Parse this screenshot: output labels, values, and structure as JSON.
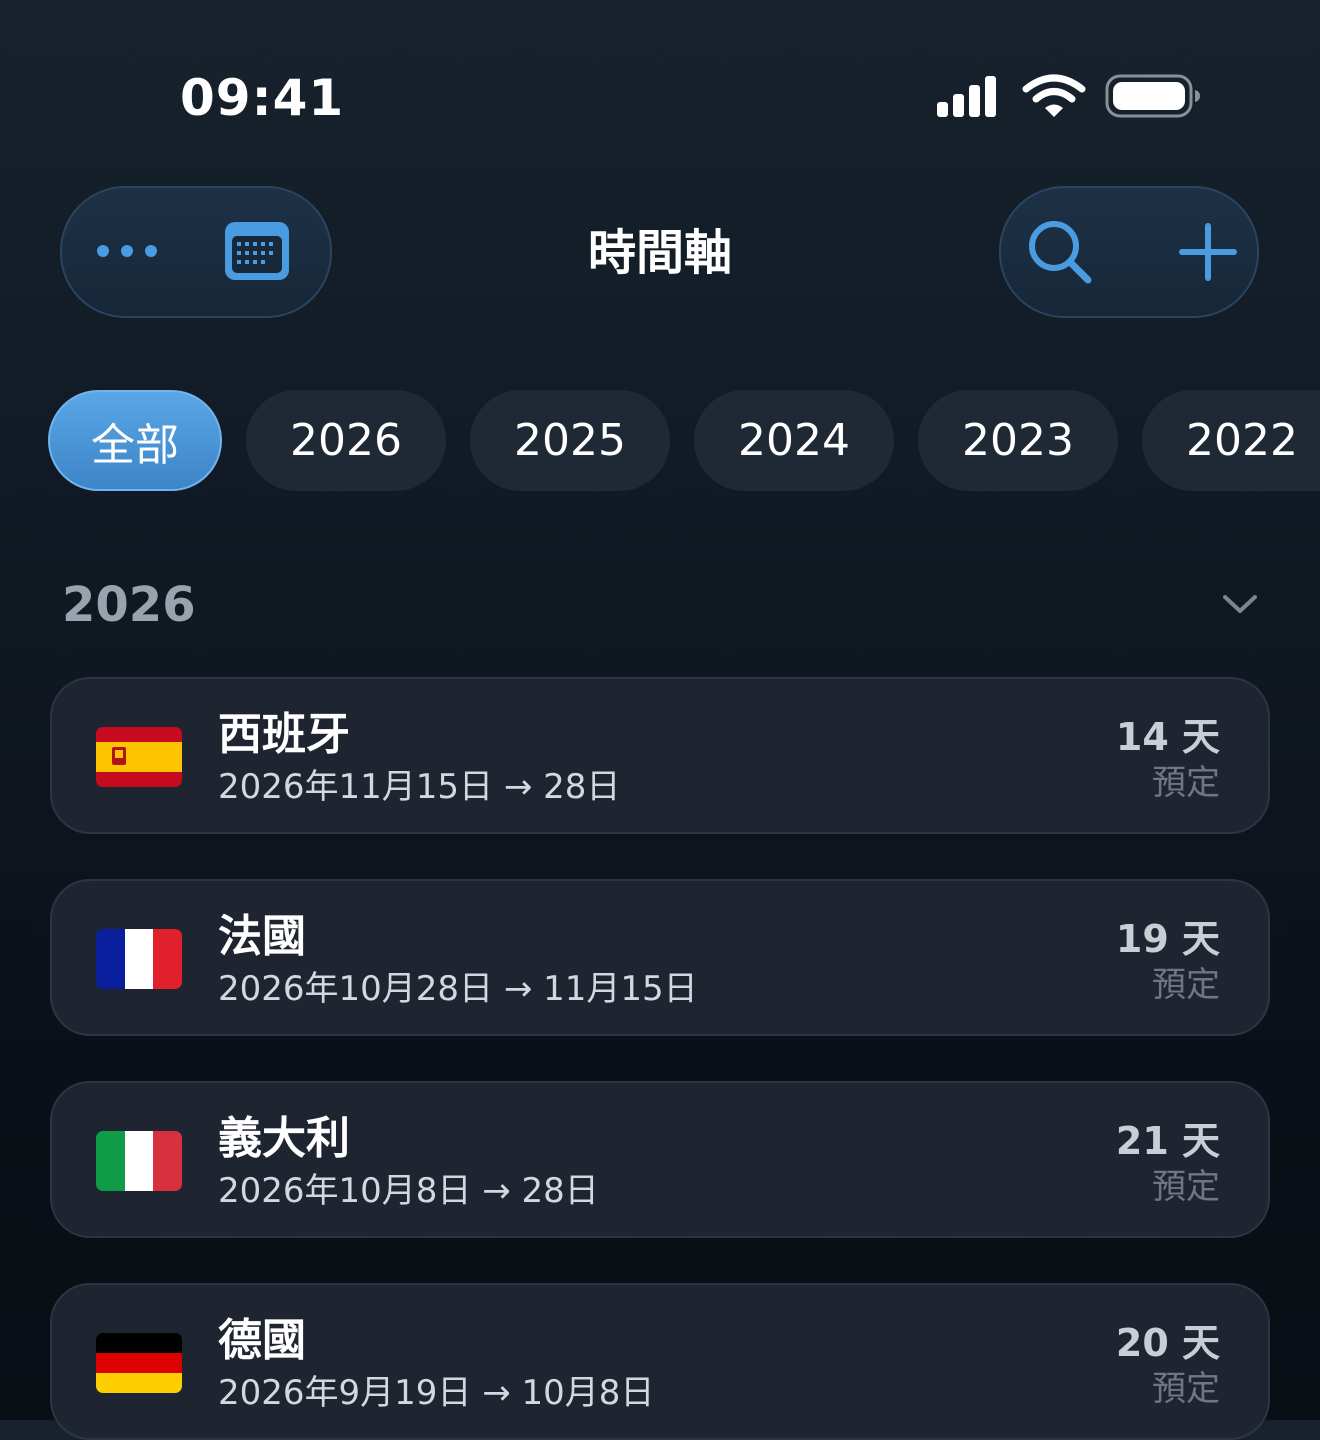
{
  "status_bar": {
    "time": "09:41",
    "signal_icon": "cellular-signal-icon",
    "wifi_icon": "wifi-icon",
    "battery_icon": "battery-icon"
  },
  "toolbar": {
    "title": "時間軸",
    "more_icon": "ellipsis-icon",
    "calendar_icon": "calendar-icon",
    "search_icon": "search-icon",
    "add_icon": "plus-icon",
    "accent_color": "#4a9be0"
  },
  "filters": [
    {
      "label": "全部",
      "active": true
    },
    {
      "label": "2026",
      "active": false
    },
    {
      "label": "2025",
      "active": false
    },
    {
      "label": "2024",
      "active": false
    },
    {
      "label": "2023",
      "active": false
    },
    {
      "label": "2022",
      "active": false
    }
  ],
  "section": {
    "year": "2026",
    "toggle_icon": "chevron-down-icon"
  },
  "trips": [
    {
      "country": "西班牙",
      "flag": "spain-flag-icon",
      "dates": "2026年11月15日 → 28日",
      "days": "14 天",
      "status": "預定"
    },
    {
      "country": "法國",
      "flag": "france-flag-icon",
      "dates": "2026年10月28日 → 11月15日",
      "days": "19 天",
      "status": "預定"
    },
    {
      "country": "義大利",
      "flag": "italy-flag-icon",
      "dates": "2026年10月8日 → 28日",
      "days": "21 天",
      "status": "預定"
    },
    {
      "country": "德國",
      "flag": "germany-flag-icon",
      "dates": "2026年9月19日 → 10月8日",
      "days": "20 天",
      "status": "預定"
    }
  ]
}
